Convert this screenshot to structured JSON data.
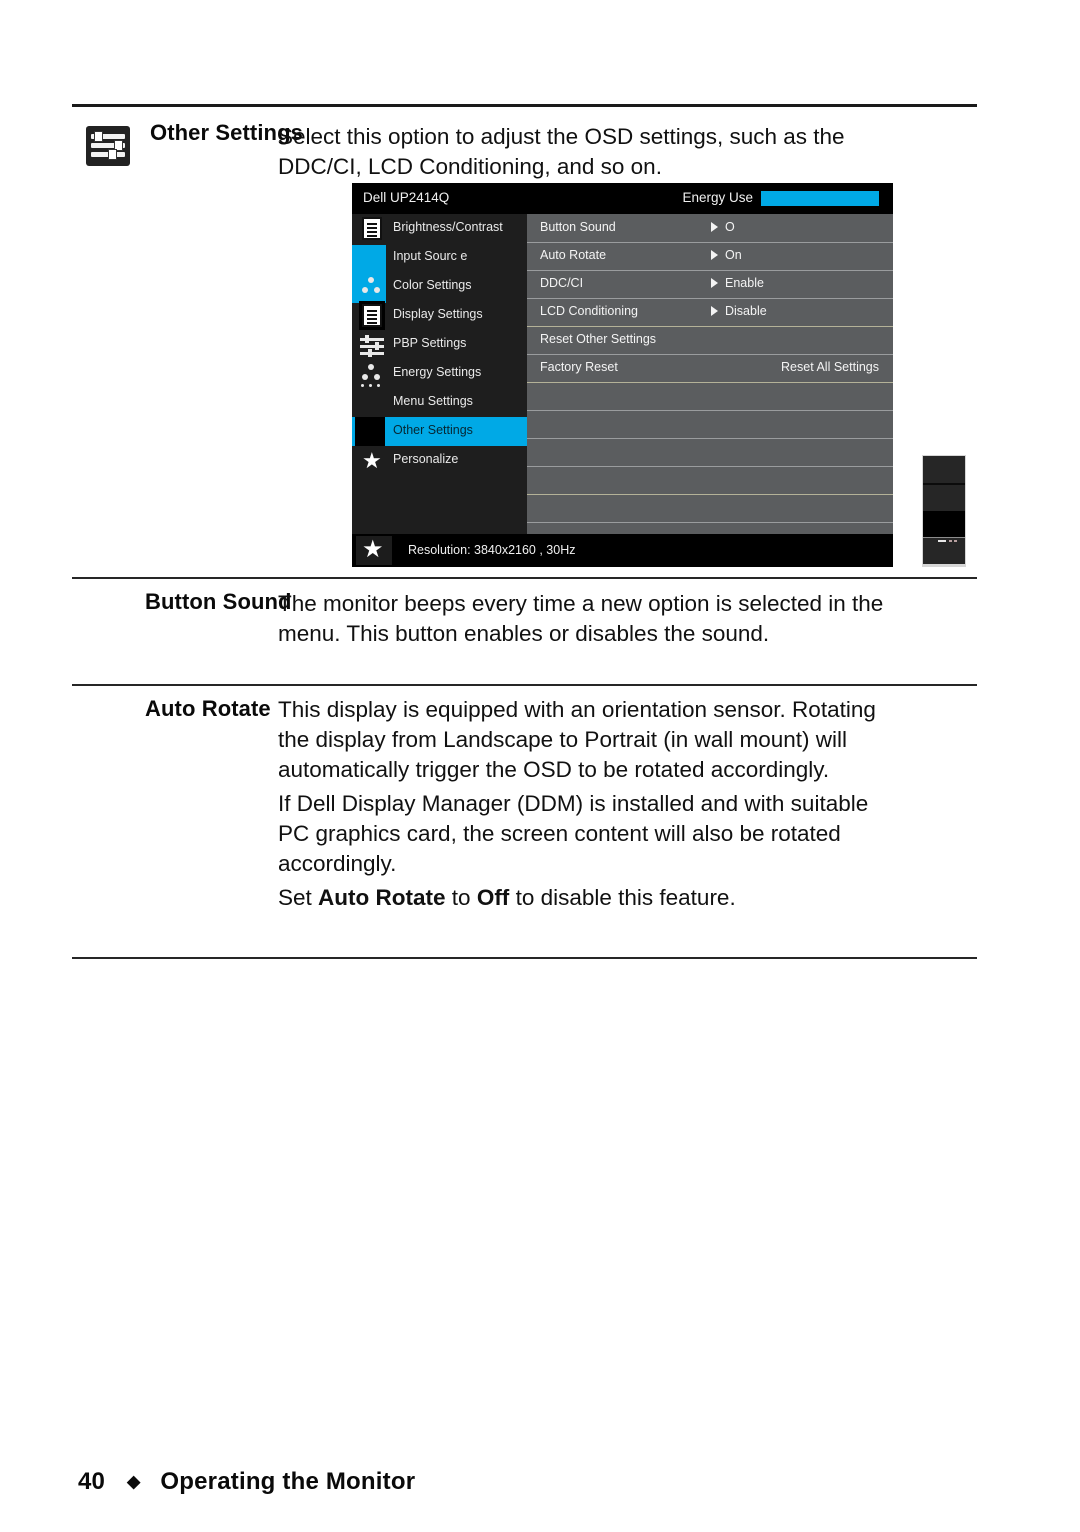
{
  "page": {
    "number": "40",
    "separator": "◆",
    "section_title": "Operating the Monitor"
  },
  "entries": [
    {
      "term": "Other Settings",
      "icon": "sliders-icon",
      "paragraphs": [
        "Select this option to adjust the OSD settings, such as the DDC/CI, LCD Conditioning, and so on."
      ]
    },
    {
      "term": "Button Sound",
      "paragraphs": [
        "The monitor beeps every time a new option is selected in the menu. This button enables or disables the sound."
      ]
    },
    {
      "term": "Auto Rotate",
      "paragraphs": [
        "This display is equipped with an orientation sensor. Rotating the display from Landscape to Portrait (in wall mount) will automatically trigger the OSD to be rotated accordingly.",
        "If Dell Display Manager (DDM) is installed and with suitable PC graphics card, the screen content will also be rotated accordingly."
      ],
      "closing": {
        "prefix": "Set ",
        "bold1": "Auto Rotate",
        "middle": " to ",
        "bold2": "Off",
        "suffix": " to disable this feature."
      }
    }
  ],
  "osd": {
    "title": "Dell UP2414Q",
    "energy_label": "Energy Use",
    "accent_color": "#00a9e6",
    "pane_color": "#5b5d5f",
    "nav": [
      {
        "label": "Brightness/Contrast",
        "icon": "brightness-contrast-icon",
        "selected": false
      },
      {
        "label": "Input Sourc e",
        "icon": "input-source-icon",
        "selected": false
      },
      {
        "label": "Color Settings",
        "icon": "color-settings-icon",
        "selected": false
      },
      {
        "label": "Display Settings",
        "icon": "display-settings-icon",
        "selected": false
      },
      {
        "label": "PBP Settings",
        "icon": "pbp-settings-icon",
        "selected": false
      },
      {
        "label": "Energy Settings",
        "icon": "energy-settings-icon",
        "selected": false
      },
      {
        "label": "Menu Settings",
        "icon": "menu-settings-icon",
        "selected": false
      },
      {
        "label": "Other Settings",
        "icon": "other-settings-icon",
        "selected": true
      },
      {
        "label": "Personalize",
        "icon": "personalize-star-icon",
        "selected": false
      }
    ],
    "options": [
      {
        "label": "Button Sound",
        "value": "O",
        "has_arrow": true
      },
      {
        "label": "Auto Rotate",
        "value": "On",
        "has_arrow": true
      },
      {
        "label": "DDC/CI",
        "value": "Enable",
        "has_arrow": true
      },
      {
        "label": "LCD Conditioning",
        "value": "Disable",
        "has_arrow": true
      },
      {
        "label": "Reset Other Settings",
        "value": "",
        "has_arrow": false
      },
      {
        "label": "Factory Reset",
        "value": "Reset All Settings",
        "has_arrow": false
      }
    ],
    "status": "Resolution: 3840x2160  , 30Hz"
  }
}
